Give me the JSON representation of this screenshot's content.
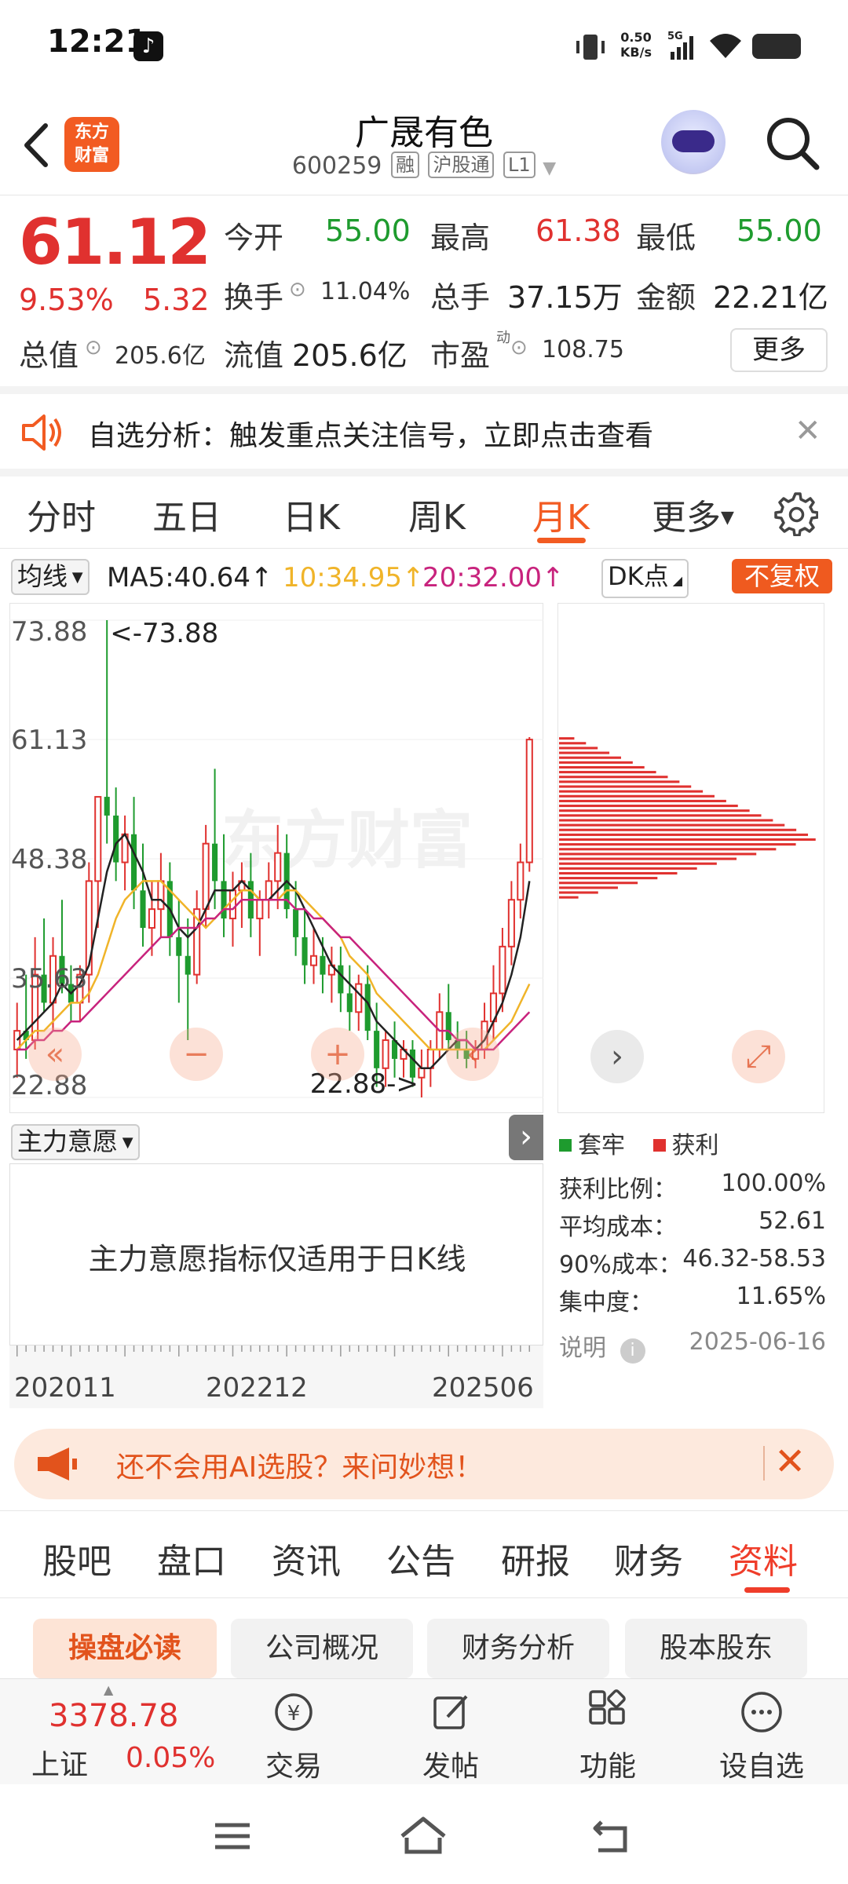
{
  "status": {
    "time": "12:21",
    "net_speed_value": "0.50",
    "net_speed_unit": "KB/s",
    "network": "5G"
  },
  "header": {
    "logo_line1": "东方",
    "logo_line2": "财富",
    "stock_name": "广晟有色",
    "stock_code": "600259",
    "tags": [
      "融",
      "沪股通",
      "L1"
    ]
  },
  "quote": {
    "price": "61.12",
    "change_pct": "9.53%",
    "change": "5.32",
    "fields": {
      "open_label": "今开",
      "open": "55.00",
      "high_label": "最高",
      "high": "61.38",
      "low_label": "最低",
      "low": "55.00",
      "turnover_label": "换手",
      "turnover": "11.04%",
      "volume_label": "总手",
      "volume": "37.15万",
      "amount_label": "金额",
      "amount": "22.21亿",
      "mcap_label": "总值",
      "mcap": "205.6亿",
      "float_label": "流值",
      "float": "205.6亿",
      "pe_label": "市盈",
      "pe_sup": "动",
      "pe": "108.75"
    },
    "more_label": "更多"
  },
  "banner": {
    "text": "自选分析：触发重点关注信号，立即点击查看"
  },
  "chart_tabs": {
    "items": [
      "分时",
      "五日",
      "日K",
      "周K",
      "月K",
      "更多"
    ],
    "active": "月K"
  },
  "ma_row": {
    "select_label": "均线",
    "ma5": "MA5:40.64",
    "ma10": "10:34.95",
    "ma20": "20:32.00",
    "dk_label": "DK点",
    "adjust_label": "不复权"
  },
  "colors": {
    "up": "#e0312f",
    "down": "#1e9b2e",
    "ma5": "#222222",
    "ma10": "#f0b429",
    "ma20": "#c8237d",
    "brand": "#f25b22"
  },
  "chart_data": {
    "type": "candlestick",
    "period": "monthly",
    "y_ticks": [
      "73.88",
      "61.13",
      "48.38",
      "35.63",
      "22.88"
    ],
    "ylim": [
      22.88,
      73.88
    ],
    "x_ticks": [
      "202011",
      "202212",
      "202506"
    ],
    "max_marker": "<-73.88",
    "min_marker": "22.88->",
    "candles": [
      {
        "o": 28,
        "h": 33,
        "l": 25,
        "c": 30
      },
      {
        "o": 30,
        "h": 36,
        "l": 27,
        "c": 29
      },
      {
        "o": 29,
        "h": 40,
        "l": 28,
        "c": 36
      },
      {
        "o": 36,
        "h": 42,
        "l": 32,
        "c": 33
      },
      {
        "o": 33,
        "h": 40,
        "l": 30,
        "c": 38
      },
      {
        "o": 38,
        "h": 44,
        "l": 34,
        "c": 35
      },
      {
        "o": 35,
        "h": 37,
        "l": 31,
        "c": 33
      },
      {
        "o": 33,
        "h": 37,
        "l": 31,
        "c": 36
      },
      {
        "o": 36,
        "h": 48,
        "l": 33,
        "c": 46
      },
      {
        "o": 46,
        "h": 55,
        "l": 41,
        "c": 55
      },
      {
        "o": 55,
        "h": 73.88,
        "l": 50,
        "c": 53
      },
      {
        "o": 53,
        "h": 56,
        "l": 46,
        "c": 48
      },
      {
        "o": 48,
        "h": 53,
        "l": 45,
        "c": 51
      },
      {
        "o": 51,
        "h": 55,
        "l": 43,
        "c": 45
      },
      {
        "o": 45,
        "h": 50,
        "l": 39,
        "c": 41
      },
      {
        "o": 41,
        "h": 46,
        "l": 38,
        "c": 43
      },
      {
        "o": 43,
        "h": 49,
        "l": 40,
        "c": 46
      },
      {
        "o": 46,
        "h": 48,
        "l": 38,
        "c": 40
      },
      {
        "o": 40,
        "h": 44,
        "l": 33,
        "c": 38
      },
      {
        "o": 38,
        "h": 42,
        "l": 29,
        "c": 36
      },
      {
        "o": 36,
        "h": 45,
        "l": 35,
        "c": 43
      },
      {
        "o": 43,
        "h": 52,
        "l": 41,
        "c": 50
      },
      {
        "o": 50,
        "h": 58,
        "l": 43,
        "c": 46
      },
      {
        "o": 46,
        "h": 51,
        "l": 40,
        "c": 42
      },
      {
        "o": 42,
        "h": 47,
        "l": 39,
        "c": 45
      },
      {
        "o": 45,
        "h": 48,
        "l": 41,
        "c": 46
      },
      {
        "o": 46,
        "h": 49,
        "l": 40,
        "c": 42
      },
      {
        "o": 42,
        "h": 45,
        "l": 38,
        "c": 44
      },
      {
        "o": 44,
        "h": 48,
        "l": 42,
        "c": 46
      },
      {
        "o": 46,
        "h": 52,
        "l": 43,
        "c": 49
      },
      {
        "o": 49,
        "h": 51,
        "l": 42,
        "c": 43
      },
      {
        "o": 43,
        "h": 46,
        "l": 38,
        "c": 40
      },
      {
        "o": 40,
        "h": 43,
        "l": 35,
        "c": 37
      },
      {
        "o": 37,
        "h": 41,
        "l": 35,
        "c": 38
      },
      {
        "o": 38,
        "h": 40,
        "l": 34,
        "c": 36
      },
      {
        "o": 36,
        "h": 39,
        "l": 33,
        "c": 37
      },
      {
        "o": 37,
        "h": 39,
        "l": 32,
        "c": 34
      },
      {
        "o": 34,
        "h": 37,
        "l": 30,
        "c": 32
      },
      {
        "o": 32,
        "h": 36,
        "l": 30,
        "c": 35
      },
      {
        "o": 35,
        "h": 37,
        "l": 29,
        "c": 30
      },
      {
        "o": 30,
        "h": 33,
        "l": 24,
        "c": 26
      },
      {
        "o": 26,
        "h": 30,
        "l": 24,
        "c": 29
      },
      {
        "o": 29,
        "h": 31,
        "l": 25,
        "c": 27
      },
      {
        "o": 27,
        "h": 29,
        "l": 25,
        "c": 28
      },
      {
        "o": 28,
        "h": 29,
        "l": 24,
        "c": 25
      },
      {
        "o": 25,
        "h": 28,
        "l": 22.88,
        "c": 26
      },
      {
        "o": 26,
        "h": 29,
        "l": 24,
        "c": 28
      },
      {
        "o": 28,
        "h": 34,
        "l": 27,
        "c": 32
      },
      {
        "o": 32,
        "h": 35,
        "l": 28,
        "c": 29
      },
      {
        "o": 29,
        "h": 31,
        "l": 27,
        "c": 28
      },
      {
        "o": 28,
        "h": 30,
        "l": 26,
        "c": 27
      },
      {
        "o": 27,
        "h": 29,
        "l": 26,
        "c": 28
      },
      {
        "o": 28,
        "h": 33,
        "l": 27,
        "c": 31
      },
      {
        "o": 31,
        "h": 37,
        "l": 29,
        "c": 34
      },
      {
        "o": 34,
        "h": 41,
        "l": 32,
        "c": 39
      },
      {
        "o": 39,
        "h": 46,
        "l": 37,
        "c": 44
      },
      {
        "o": 44,
        "h": 50,
        "l": 42,
        "c": 48
      },
      {
        "o": 48,
        "h": 61.38,
        "l": 47,
        "c": 61.12
      }
    ],
    "ma5_series": [
      29,
      30,
      31,
      32,
      33,
      35,
      34,
      35,
      37,
      42,
      47,
      50,
      51,
      49,
      47,
      44,
      44,
      43,
      41,
      40,
      41,
      43,
      45,
      45,
      45,
      46,
      45,
      44,
      44,
      45,
      46,
      45,
      43,
      41,
      39,
      37,
      36,
      35,
      34,
      33,
      31,
      30,
      29,
      28,
      27,
      26,
      26,
      27,
      28,
      29,
      29,
      28,
      29,
      31,
      33,
      36,
      40,
      46
    ],
    "ma10_series": [
      28,
      29,
      30,
      30,
      31,
      32,
      33,
      33,
      34,
      36,
      39,
      42,
      44,
      45,
      46,
      46,
      46,
      45,
      44,
      43,
      42,
      41,
      42,
      43,
      44,
      45,
      45,
      44,
      44,
      44,
      45,
      45,
      44,
      43,
      42,
      41,
      40,
      38,
      37,
      36,
      34,
      33,
      32,
      31,
      30,
      29,
      28,
      28,
      28,
      28,
      28,
      28,
      28,
      29,
      30,
      31,
      33,
      35
    ],
    "ma20_series": [
      28,
      28,
      29,
      29,
      30,
      30,
      31,
      31,
      32,
      33,
      34,
      35,
      36,
      37,
      38,
      39,
      40,
      40,
      41,
      41,
      41,
      42,
      42,
      43,
      43,
      44,
      44,
      44,
      44,
      44,
      44,
      43,
      43,
      42,
      42,
      41,
      40,
      40,
      39,
      38,
      37,
      36,
      35,
      34,
      33,
      32,
      31,
      30,
      30,
      29,
      29,
      28,
      28,
      28,
      29,
      30,
      31,
      32
    ],
    "chip_distribution": {
      "price_range": [
        44,
        61.5
      ],
      "peak_price": 50.5
    }
  },
  "indicator": {
    "select_label": "主力意愿",
    "message": "主力意愿指标仅适用于日K线"
  },
  "chips": {
    "legend": [
      "套牢",
      "获利"
    ],
    "stats": [
      {
        "label": "获利比例：",
        "value": "100.00%"
      },
      {
        "label": "平均成本：",
        "value": "52.61"
      },
      {
        "label": "90%成本：",
        "value": "46.32-58.53"
      },
      {
        "label": "集中度：",
        "value": "11.65%"
      }
    ],
    "note_label": "说明",
    "date": "2025-06-16"
  },
  "ai_banner": {
    "text": "还不会用AI选股？来问妙想！"
  },
  "sub_nav": {
    "items": [
      "股吧",
      "盘口",
      "资讯",
      "公告",
      "研报",
      "财务",
      "资料"
    ],
    "active": "资料"
  },
  "info_chips": [
    "操盘必读",
    "公司概况",
    "财务分析",
    "股本股东"
  ],
  "bottom_bar": {
    "index_value": "3378.78",
    "index_name": "上证",
    "index_change": "0.05%",
    "items": [
      "交易",
      "发帖",
      "功能",
      "设自选"
    ]
  }
}
